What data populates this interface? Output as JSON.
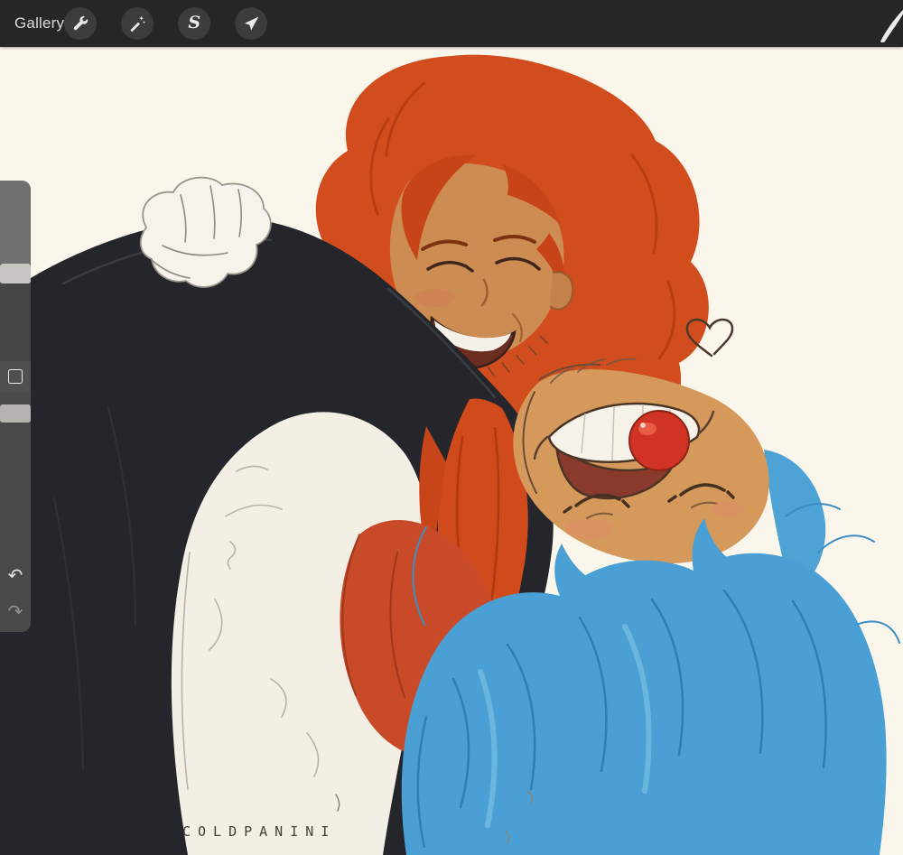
{
  "toolbar": {
    "gallery_label": "Gallery",
    "left_buttons": [
      {
        "id": "actions",
        "icon": "wrench-icon"
      },
      {
        "id": "adjustments",
        "icon": "magic-wand-icon"
      },
      {
        "id": "selection",
        "icon": "selection-s-icon",
        "glyph": "S"
      },
      {
        "id": "transform",
        "icon": "transform-arrow-icon"
      }
    ],
    "right_buttons": [
      {
        "id": "paint",
        "icon": "brush-icon"
      }
    ]
  },
  "sidebar": {
    "sliders": [
      {
        "id": "brush-size-slider"
      },
      {
        "id": "opacity-slider"
      }
    ],
    "modify_button": {
      "icon": "square-icon"
    },
    "undo": {
      "icon": "undo-arrow-icon",
      "glyph": "↶"
    },
    "redo": {
      "icon": "redo-arrow-icon",
      "glyph": "↷"
    }
  },
  "canvas": {
    "signature": "COLDPANINI"
  },
  "colors": {
    "topbar_bg": "#262626",
    "tool_button_bg": "#3c3c3c",
    "icon_color": "#e9e9e9",
    "canvas_bg": "#faf6eb",
    "sidebar_bg": "#4e4e4e",
    "slider_handle": "#c7c5c2",
    "hair_red": "#d14a1c",
    "hair_blue": "#4aa0d4",
    "coat_dark": "#24262b",
    "skin_tan": "#cd8c52",
    "buggy_skin": "#d6995c",
    "nose_red": "#d03223",
    "garment_red": "#c94a28",
    "shirt_white": "#f3efe5"
  }
}
